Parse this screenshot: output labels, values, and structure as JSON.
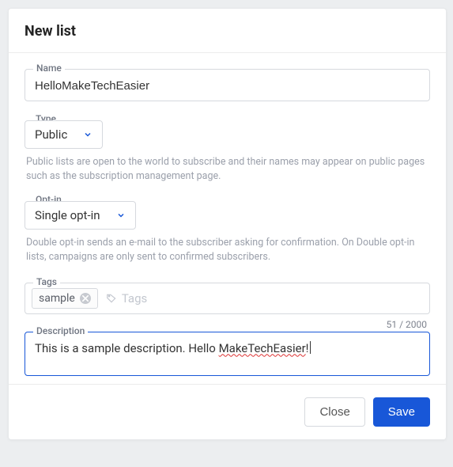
{
  "header": {
    "title": "New list"
  },
  "fields": {
    "name": {
      "label": "Name",
      "value": "HelloMakeTechEasier"
    },
    "type": {
      "label": "Type",
      "value": "Public",
      "help": "Public lists are open to the world to subscribe and their names may appear on public pages such as the subscription management page."
    },
    "optin": {
      "label": "Opt-in",
      "value": "Single opt-in",
      "help": "Double opt-in sends an e-mail to the subscriber asking for confirmation. On Double opt-in lists, campaigns are only sent to confirmed subscribers."
    },
    "tags": {
      "label": "Tags",
      "items": [
        "sample"
      ],
      "placeholder": "Tags"
    },
    "description": {
      "label": "Description",
      "text_plain": "This is a sample description. Hello ",
      "text_spellerr": "MakeTechEasier",
      "text_after": "!",
      "count": "51 / 2000"
    }
  },
  "footer": {
    "close": "Close",
    "save": "Save"
  },
  "colors": {
    "accent": "#1857d8"
  }
}
